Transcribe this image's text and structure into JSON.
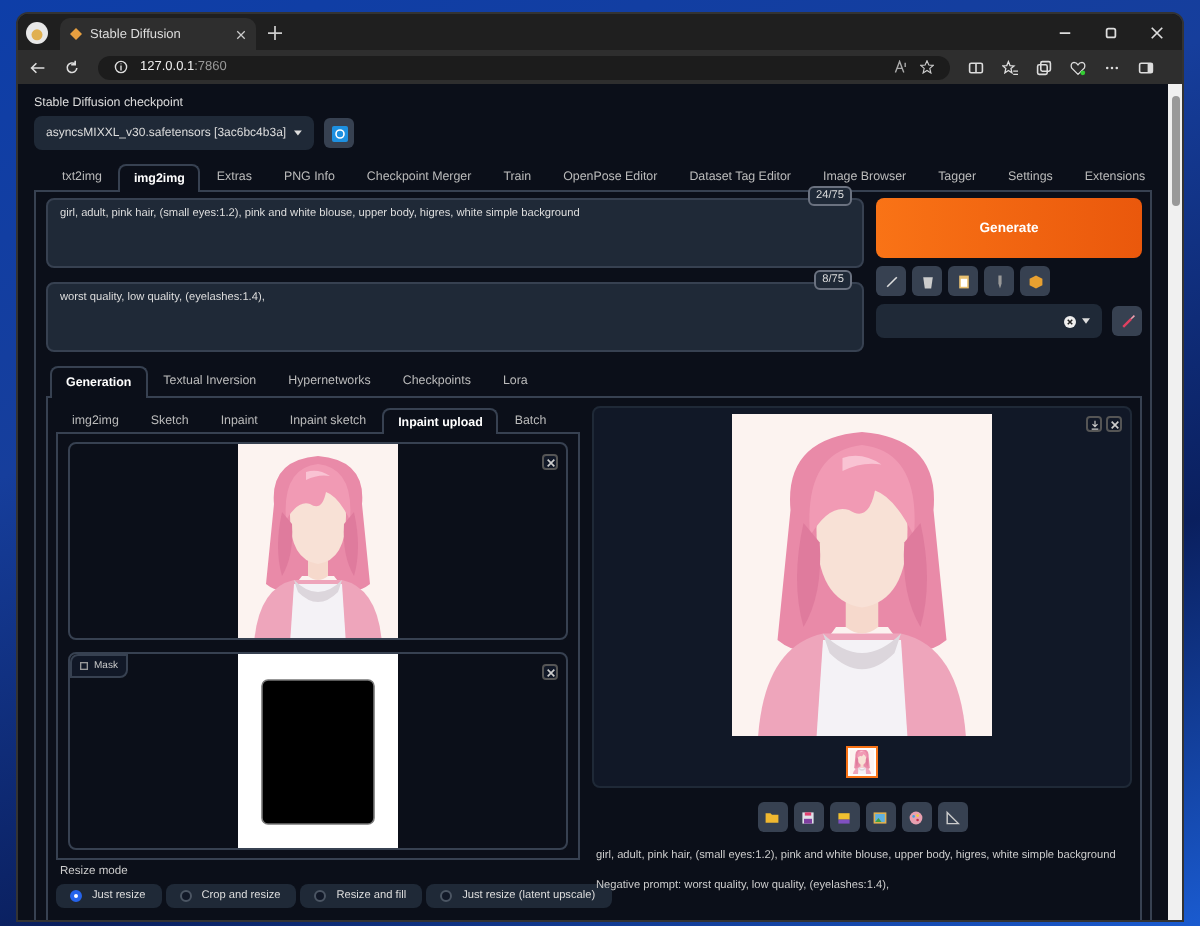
{
  "browser": {
    "tab_title": "Stable Diffusion",
    "url_host": "127.0.0.1",
    "url_port": ":7860"
  },
  "checkpoint": {
    "label": "Stable Diffusion checkpoint",
    "value": "asyncsMIXXL_v30.safetensors [3ac6bc4b3a]"
  },
  "main_tabs": [
    {
      "label": "txt2img",
      "selected": false
    },
    {
      "label": "img2img",
      "selected": true
    },
    {
      "label": "Extras",
      "selected": false
    },
    {
      "label": "PNG Info",
      "selected": false
    },
    {
      "label": "Checkpoint Merger",
      "selected": false
    },
    {
      "label": "Train",
      "selected": false
    },
    {
      "label": "OpenPose Editor",
      "selected": false
    },
    {
      "label": "Dataset Tag Editor",
      "selected": false
    },
    {
      "label": "Image Browser",
      "selected": false
    },
    {
      "label": "Tagger",
      "selected": false
    },
    {
      "label": "Settings",
      "selected": false
    },
    {
      "label": "Extensions",
      "selected": false
    }
  ],
  "prompt": {
    "value": "girl, adult, pink hair, (small eyes:1.2), pink and white blouse, upper body, higres, white simple background",
    "counter": "24/75"
  },
  "negative_prompt": {
    "value": "worst quality, low quality, (eyelashes:1.4),",
    "counter": "8/75"
  },
  "generate_label": "Generate",
  "extra_tabs": [
    {
      "label": "Generation",
      "selected": true
    },
    {
      "label": "Textual Inversion",
      "selected": false
    },
    {
      "label": "Hypernetworks",
      "selected": false
    },
    {
      "label": "Checkpoints",
      "selected": false
    },
    {
      "label": "Lora",
      "selected": false
    }
  ],
  "mode_tabs": [
    {
      "label": "img2img",
      "selected": false
    },
    {
      "label": "Sketch",
      "selected": false
    },
    {
      "label": "Inpaint",
      "selected": false
    },
    {
      "label": "Inpaint sketch",
      "selected": false
    },
    {
      "label": "Inpaint upload",
      "selected": true
    },
    {
      "label": "Batch",
      "selected": false
    }
  ],
  "mask_label": "Mask",
  "resize_mode": {
    "label": "Resize mode",
    "options": [
      {
        "label": "Just resize",
        "selected": true
      },
      {
        "label": "Crop and resize",
        "selected": false
      },
      {
        "label": "Resize and fill",
        "selected": false
      },
      {
        "label": "Just resize (latent upscale)",
        "selected": false
      }
    ]
  },
  "output": {
    "info": "girl, adult, pink hair, (small eyes:1.2), pink and white blouse, upper body, higres, white simple background",
    "negative": "Negative prompt: worst quality, low quality, (eyelashes:1.4),"
  }
}
